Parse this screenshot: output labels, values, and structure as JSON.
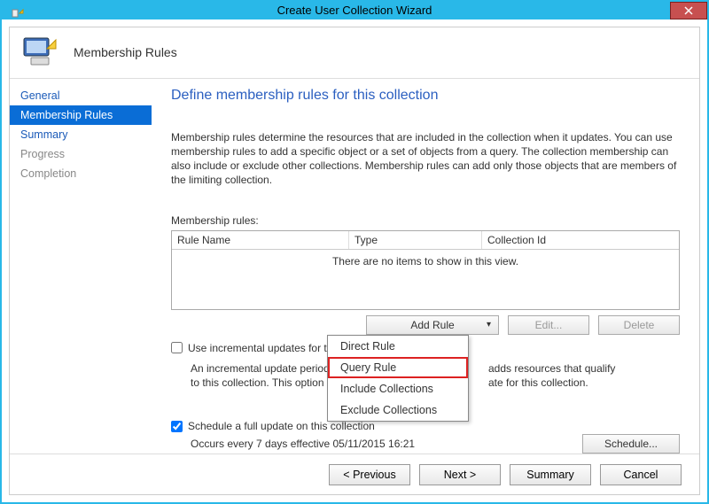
{
  "window": {
    "title": "Create User Collection Wizard"
  },
  "header": {
    "title": "Membership Rules"
  },
  "sidebar": {
    "items": [
      {
        "label": "General",
        "kind": "link"
      },
      {
        "label": "Membership Rules",
        "kind": "selected"
      },
      {
        "label": "Summary",
        "kind": "link"
      },
      {
        "label": "Progress",
        "kind": "dim"
      },
      {
        "label": "Completion",
        "kind": "dim"
      }
    ]
  },
  "main": {
    "title": "Define membership rules for this collection",
    "description": "Membership rules determine the resources that are included in the collection when it updates. You can use membership rules to add a specific object or a set of objects from a query. The collection membership can also include or exclude other collections. Membership rules can add only those objects that are members of the limiting collection.",
    "grid": {
      "label": "Membership rules:",
      "columns": {
        "name": "Rule Name",
        "type": "Type",
        "coll": "Collection Id"
      },
      "empty_text": "There are no items to show in this view."
    },
    "buttons": {
      "add_rule": "Add Rule",
      "edit": "Edit...",
      "delete": "Delete",
      "schedule": "Schedule..."
    },
    "dropdown_items": [
      "Direct Rule",
      "Query Rule",
      "Include Collections",
      "Exclude Collections"
    ],
    "incremental": {
      "checkbox_label": "Use incremental updates for this collection",
      "text_pre": "An incremental update periodically",
      "text_post_a": "adds resources that qualify",
      "text_line2_pre": "to this collection. This option doe",
      "text_line2_post": "ate for this collection."
    },
    "schedule": {
      "checkbox_label": "Schedule a full update on this collection",
      "occurs": "Occurs every 7 days effective 05/11/2015 16:21"
    }
  },
  "footer": {
    "previous": "< Previous",
    "next": "Next >",
    "summary": "Summary",
    "cancel": "Cancel"
  }
}
